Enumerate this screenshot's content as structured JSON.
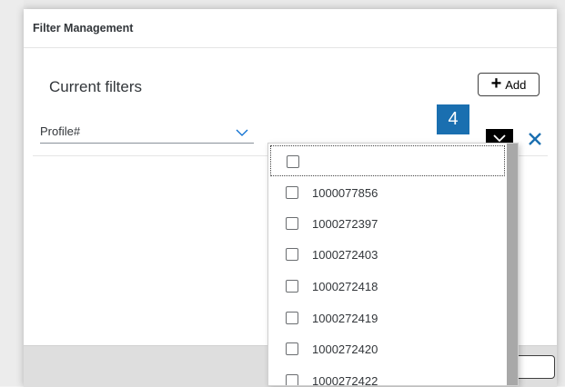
{
  "dialog": {
    "title": "Filter Management",
    "section_title": "Current filters",
    "add_button": {
      "icon": "plus-icon",
      "label": "Add"
    }
  },
  "filter_row": {
    "field_value": "Profile#",
    "step_number": "4",
    "toggle_icon": "chevron-down-icon",
    "remove_icon": "close-icon"
  },
  "dropdown": {
    "options": [
      {
        "label": "",
        "checked": false
      },
      {
        "label": "1000077856",
        "checked": false
      },
      {
        "label": "1000272397",
        "checked": false
      },
      {
        "label": "1000272403",
        "checked": false
      },
      {
        "label": "1000272418",
        "checked": false
      },
      {
        "label": "1000272419",
        "checked": false
      },
      {
        "label": "1000272420",
        "checked": false
      },
      {
        "label": "1000272422",
        "checked": false
      }
    ]
  },
  "colors": {
    "accent": "#1a6fb0",
    "remove": "#1a6fb0",
    "text": "#32363a"
  }
}
